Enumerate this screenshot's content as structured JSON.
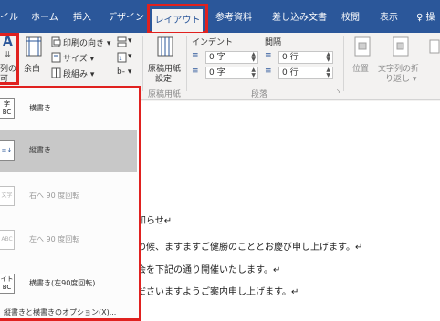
{
  "tabs": [
    {
      "label": "イル"
    },
    {
      "label": "ホーム"
    },
    {
      "label": "挿入"
    },
    {
      "label": "デザイン"
    },
    {
      "label": "レイアウト"
    },
    {
      "label": "参考資料"
    },
    {
      "label": "差し込み文書"
    },
    {
      "label": "校閲"
    },
    {
      "label": "表示"
    },
    {
      "label": "♀ 操"
    }
  ],
  "ribbon": {
    "direction_top": "A",
    "direction_l1": "列の",
    "direction_l2": "可",
    "margins": "余白",
    "print_orientation": "印刷の向き ▾",
    "size": "サイズ ▾",
    "columns": "段組み ▾",
    "breaks": "▾",
    "line_numbers": "▾",
    "hyphen": "b‐ ▾",
    "manuscript_1": "原稿用紙",
    "manuscript_2": "設定",
    "manuscript_group": "原稿用紙",
    "indent_header": "インデント",
    "spacing_header": "間隔",
    "indent_left": "0 字",
    "indent_right": "0 字",
    "spacing_before": "0 行",
    "spacing_after": "0 行",
    "paragraph_group": "段落",
    "position": "位置",
    "wrap_1": "文字列の折",
    "wrap_2": "り返し ▾"
  },
  "menu": {
    "items": [
      {
        "label": "横書き",
        "icon_text": "字\nBC",
        "state": "normal"
      },
      {
        "label": "縦書き",
        "icon_text": "≡↓",
        "state": "selected"
      },
      {
        "label": "右へ 90 度回転",
        "icon_text": "文字",
        "state": "disabled"
      },
      {
        "label": "左へ 90 度回転",
        "icon_text": "ABC",
        "state": "disabled"
      },
      {
        "label": "横書き(左90度回転)",
        "icon_text": "イト\nBC",
        "state": "normal"
      }
    ],
    "options": "縦書きと横書きのオプション(X)..."
  },
  "document": {
    "line1": "知らせ↵",
    "line2": "の候、ますますご健勝のこととお慶び申し上げます。↵",
    "line3": "会を下記の通り開催いたします。↵",
    "line4": "ださいますようご案内申し上げます。↵"
  }
}
